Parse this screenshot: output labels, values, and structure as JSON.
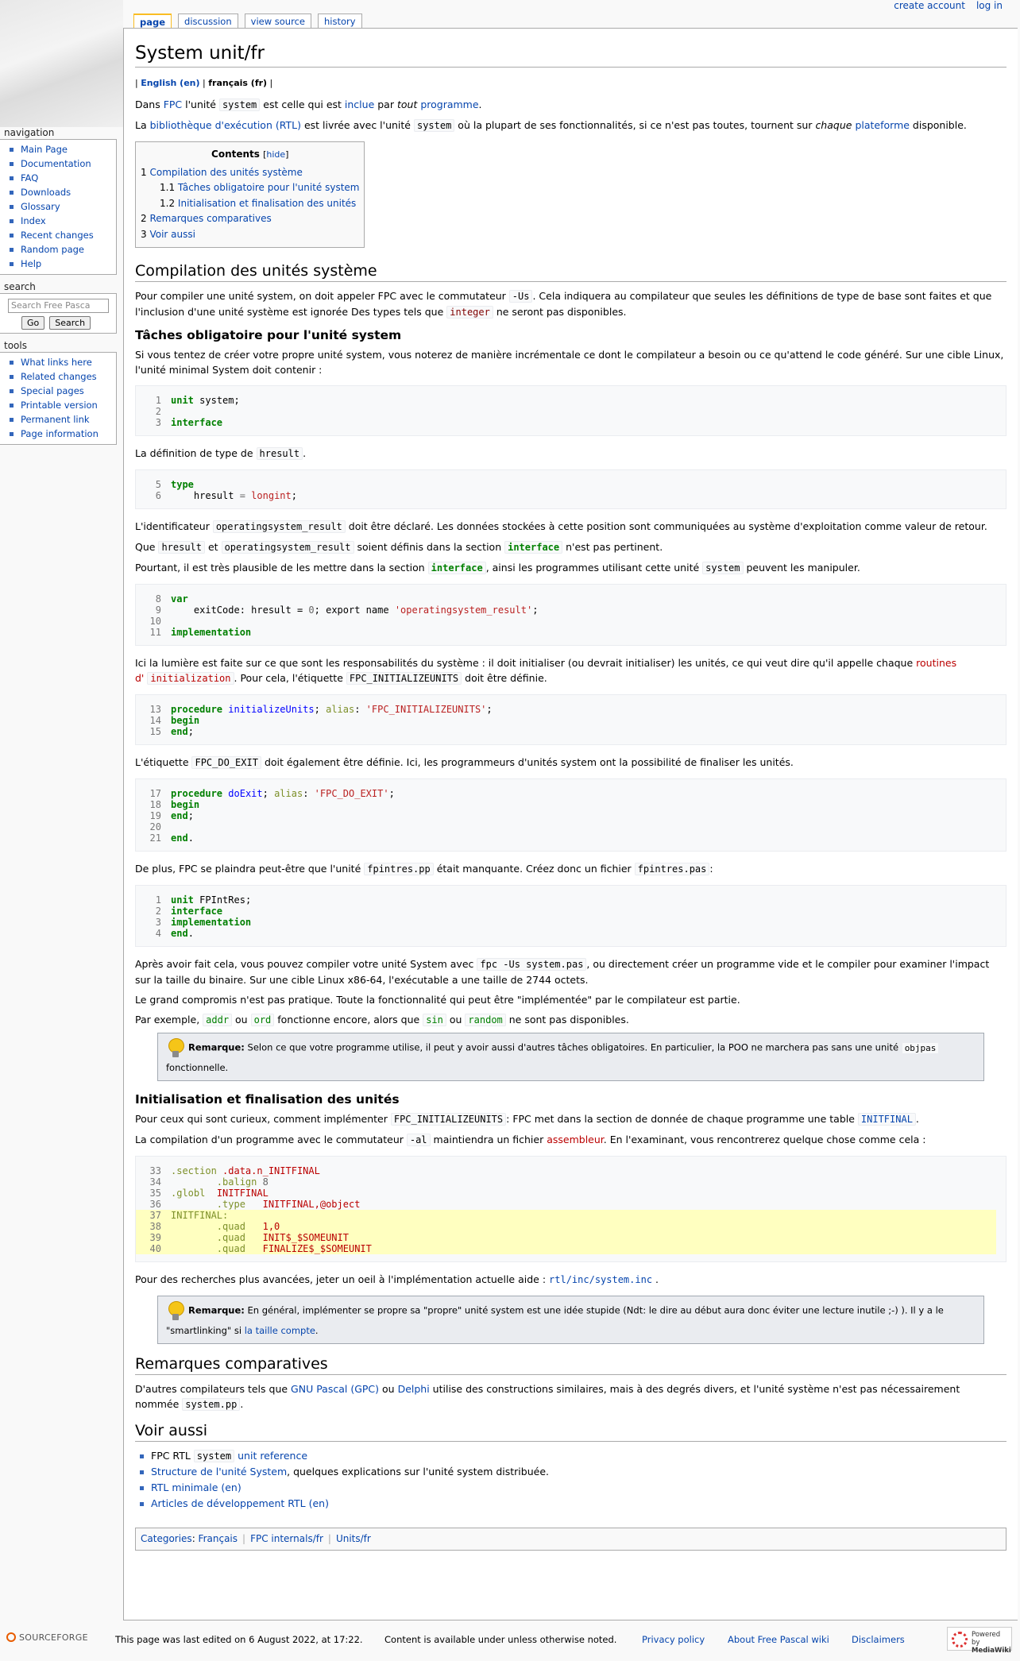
{
  "personal": {
    "create_account": "create account",
    "login": "log in"
  },
  "tabs": {
    "page": "page",
    "discussion": "discussion",
    "view_source": "view source",
    "history": "history"
  },
  "sidebar": {
    "navigation_title": "navigation",
    "navigation": [
      "Main Page",
      "Documentation",
      "FAQ",
      "Downloads",
      "Glossary",
      "Index",
      "Recent changes",
      "Random page",
      "Help"
    ],
    "search_title": "search",
    "search_placeholder": "Search Free Pasca",
    "go_label": "Go",
    "search_label": "Search",
    "tools_title": "tools",
    "tools": [
      "What links here",
      "Related changes",
      "Special pages",
      "Printable version",
      "Permanent link",
      "Page information"
    ]
  },
  "page": {
    "title": "System unit/fr",
    "lang_en": "English (en)",
    "lang_fr": "français (fr)",
    "intro1": {
      "a": "Dans ",
      "fpc": "FPC",
      "b": " l'unité ",
      "code": "system",
      "c": " est celle qui est ",
      "inclue": "inclue",
      "d": " par ",
      "tout": "tout",
      "programme": "programme",
      "e": "."
    },
    "intro2": {
      "a": "La ",
      "rtl": "bibliothèque d'exécution (RTL)",
      "b": " est livrée avec l'unité ",
      "code": "system",
      "c": " où la plupart de ses fonctionnalités, si ce n'est pas toutes, tournent sur ",
      "chaque": "chaque",
      "plateforme": "plateforme",
      "d": " disponible."
    },
    "toc": {
      "title": "Contents",
      "hide": "hide",
      "items": [
        {
          "num": "1",
          "text": "Compilation des unités système",
          "level": 1
        },
        {
          "num": "1.1",
          "text": "Tâches obligatoire pour l'unité system",
          "level": 2
        },
        {
          "num": "1.2",
          "text": "Initialisation et finalisation des unités",
          "level": 2
        },
        {
          "num": "2",
          "text": "Remarques comparatives",
          "level": 1
        },
        {
          "num": "3",
          "text": "Voir aussi",
          "level": 1
        }
      ]
    },
    "h2_compilation": "Compilation des unités système",
    "comp_p": {
      "a": "Pour compiler une unité system, on doit appeler FPC avec le commutateur ",
      "us": "-Us",
      "b": ". Cela indiquera au compilateur que seules les définitions de type de base sont faites et que l'inclusion d'une unité système est ignorée Des types tels que ",
      "integer": "integer",
      "c": " ne seront pas disponibles."
    },
    "h3_taches": "Tâches obligatoire pour l'unité system",
    "taches_p": "Si vous tentez de créer votre propre unité system, vous noterez de manière incrémentale ce dont le compilateur a besoin ou ce qu'attend le code généré. Sur une cible Linux, l'unité minimal System doit contenir :",
    "hresult_p": {
      "a": "La définition de type de ",
      "code": "hresult",
      "b": "."
    },
    "opsys_p": {
      "a": "L'identificateur ",
      "code": "operatingsystem_result",
      "b": " doit être déclaré. Les données stockées à cette position sont communiquées au système d'exploitation comme valeur de retour."
    },
    "que_p": {
      "a": "Que ",
      "c1": "hresult",
      "b": " et ",
      "c2": "operatingsystem_result",
      "c": " soient définis dans la section ",
      "c3": "interface",
      "d": " n'est pas pertinent."
    },
    "pourtant_p": {
      "a": "Pourtant, il est très plausible de les mettre dans la section ",
      "c1": "interface",
      "b": ", ainsi les programmes utilisant cette unité ",
      "c2": "system",
      "c": " peuvent les manipuler."
    },
    "ici_p": {
      "a": "Ici la lumière est faite sur ce que sont les responsabilités du système : il doit initialiser (ou devrait initialiser) les unités, ce qui veut dire qu'il appelle chaque ",
      "routines": "routines",
      "d": "d'",
      "init": "initialization",
      "b": ". Pour cela, l'étiquette ",
      "code": "FPC_INITIALIZEUNITS",
      "c": " doit être définie."
    },
    "exit_p": {
      "a": "L'étiquette ",
      "code": "FPC_DO_EXIT",
      "b": " doit également être définie. Ici, les programmeurs d'unités system ont la possibilité de finaliser les unités."
    },
    "fpintres_p": {
      "a": "De plus, FPC se plaindra peut-être que l'unité ",
      "c1": "fpintres.pp",
      "b": " était manquante. Créez donc un fichier ",
      "c2": "fpintres.pas",
      "c": ":"
    },
    "apres_p": {
      "a": "Après avoir fait cela, vous pouvez compiler votre unité System avec ",
      "code": "fpc -Us system.pas",
      "b": ", ou directement créer un programme vide et le compiler pour examiner l'impact sur la taille du binaire. Sur une cible Linux x86-64, l'exécutable a une taille de 2744 octets."
    },
    "compromis_p": "Le grand compromis n'est pas pratique. Toute la fonctionnalité qui peut être \"implémentée\" par le compilateur est partie.",
    "exemple_p": {
      "a": "Par exemple, ",
      "addr": "addr",
      "b": " ou ",
      "ord": "ord",
      "c": " fonctionne encore, alors que ",
      "sin": "sin",
      "d": " ou ",
      "random": "random",
      "e": " ne sont pas disponibles."
    },
    "note1": {
      "label": "Remarque:",
      "a": " Selon ce que votre programme utilise, il peut y avoir aussi d'autres tâches obligatoires. En particulier, la POO ne marchera pas sans une unité ",
      "code": "objpas",
      "b": "fonctionnelle."
    },
    "h3_init": "Initialisation et finalisation des unités",
    "curieux_p": {
      "a": "Pour ceux qui sont curieux, comment implémenter ",
      "c1": "FPC_INITIALIZEUNITS",
      "b": ": FPC met dans la section de donnée de chaque programme une table ",
      "c2": "INITFINAL",
      "c": "."
    },
    "al_p": {
      "a": "La compilation d'un programme avec le commutateur ",
      "code": "-al",
      "b": " maintiendra un fichier ",
      "asm": "assembleur",
      "c": ". En l'examinant, vous rencontrerez quelque chose comme cela :"
    },
    "recherche_p": {
      "a": "Pour des recherches plus avancées, jeter un oeil à l'implémentation actuelle aide : ",
      "code": "rtl/inc/system.inc",
      "b": " ."
    },
    "note2": {
      "label": "Remarque:",
      "a": " En général, implémenter se propre sa \"propre\" unité system est une idée stupide (Ndt: le dire au début aura donc éviter une lecture inutile ;-) ). Il y a le \"smartlinking\" si ",
      "link": "la taille compte",
      "b": "."
    },
    "h2_remarques": "Remarques comparatives",
    "remarques_p": {
      "a": "D'autres compilateurs tels que ",
      "gpc": "GNU Pascal (GPC)",
      "b": " ou ",
      "delphi": "Delphi",
      "c": " utilise des constructions similaires, mais à des degrés divers, et l'unité système n'est pas nécessairement nommée ",
      "code": "system.pp",
      "d": "."
    },
    "h2_voir": "Voir aussi",
    "voir": {
      "i1_a": "FPC RTL ",
      "i1_code": "system",
      "i1_link": "unit reference",
      "i2_link": "Structure de l'unité System",
      "i2_b": ", quelques explications sur l'unité system distribuée.",
      "i3_link": "RTL minimale (en)",
      "i4_link": "Articles de développement RTL (en)"
    },
    "categories": {
      "label": "Categories",
      "items": [
        "Français",
        "FPC internals/fr",
        "Units/fr"
      ]
    }
  },
  "code_blocks": {
    "b1": [
      {
        "n": "1"
      },
      {
        "n": "2"
      },
      {
        "n": "3"
      }
    ],
    "b2_lines": [
      "5",
      "6"
    ],
    "b3_lines": [
      "8",
      "9",
      "10",
      "11"
    ],
    "b4_lines": [
      "13",
      "14",
      "15"
    ],
    "b5_lines": [
      "17",
      "18",
      "19",
      "20",
      "21"
    ],
    "b6_lines": [
      "1",
      "2",
      "3",
      "4"
    ],
    "b7_lines": [
      "33",
      "34",
      "35",
      "36",
      "37",
      "38",
      "39",
      "40"
    ],
    "t": {
      "unit": "unit",
      "system": "system",
      "interface": "interface",
      "type": "type",
      "hresult_decl": "hresult",
      "eq": " = ",
      "longint": "longint",
      "var": "var",
      "exitcode": "exitCode",
      "hresult": "hresult",
      "zero": "0",
      "export": "; export name ",
      "opsys_str": "'operatingsystem_result'",
      "implementation": "implementation",
      "procedure": "procedure",
      "initunits": "initializeUnits",
      "alias": "alias",
      "initstr": "'FPC_INITIALIZEUNITS'",
      "begin": "begin",
      "end": "end",
      "doexit": "doExit",
      "exitstr": "'FPC_DO_EXIT'",
      "fpintres": "FPIntRes",
      "a33": ".section",
      "a33b": ".data.n_INITFINAL",
      "a34": ".balign",
      "a34b": "8",
      "a35": ".globl",
      "a35b": "INITFINAL",
      "a36": ".type",
      "a36b": "INITFINAL,@object",
      "a37": "INITFINAL:",
      "a38": ".quad",
      "a38b": "1,0",
      "a39": ".quad",
      "a39b": "INIT$_$SOMEUNIT",
      "a40": ".quad",
      "a40b": "FINALIZE$_$SOMEUNIT"
    }
  },
  "footer": {
    "sourceforge": "SOURCEFORGE",
    "edited": "This page was last edited on 6 August 2022, at 17:22.",
    "license": "Content is available under unless otherwise noted.",
    "privacy": "Privacy policy",
    "about": "About Free Pascal wiki",
    "disclaimers": "Disclaimers",
    "powered_a": "Powered by",
    "powered_b": "MediaWiki"
  }
}
